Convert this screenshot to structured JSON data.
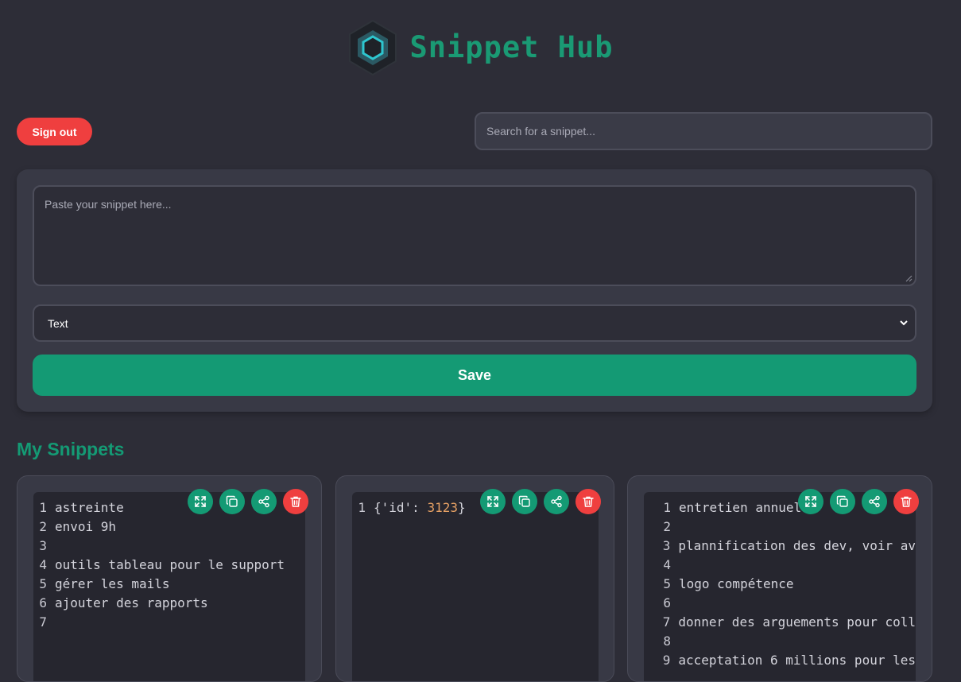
{
  "app": {
    "title": "Snippet Hub"
  },
  "toolbar": {
    "signout_label": "Sign out",
    "search_placeholder": "Search for a snippet..."
  },
  "editor": {
    "textarea_placeholder": "Paste your snippet here...",
    "language_selected": "Text",
    "save_label": "Save"
  },
  "snippets_section": {
    "title": "My Snippets"
  },
  "snippets": [
    {
      "lines": [
        {
          "n": "1",
          "text": "astreinte"
        },
        {
          "n": "2",
          "text": "envoi 9h"
        },
        {
          "n": "3",
          "text": ""
        },
        {
          "n": "4",
          "text": "outils tableau pour le support"
        },
        {
          "n": "5",
          "text": "gérer les mails"
        },
        {
          "n": "6",
          "text": "ajouter des rapports"
        },
        {
          "n": "7",
          "text": ""
        }
      ]
    },
    {
      "lines": [
        {
          "n": "1",
          "pre": "{'id': ",
          "num": "3123",
          "post": "}"
        }
      ]
    },
    {
      "lines": [
        {
          "n": "1",
          "text": "entretien annuel"
        },
        {
          "n": "2",
          "text": ""
        },
        {
          "n": "3",
          "text": "plannification des dev, voir av"
        },
        {
          "n": "4",
          "text": ""
        },
        {
          "n": "5",
          "text": "logo compétence"
        },
        {
          "n": "6",
          "text": ""
        },
        {
          "n": "7",
          "text": "donner des arguements pour coll"
        },
        {
          "n": "8",
          "text": ""
        },
        {
          "n": "9",
          "text": "acceptation 6 millions pour les"
        }
      ]
    }
  ],
  "card_actions": {
    "expand_icon": "expand-icon",
    "copy_icon": "copy-icon",
    "share_icon": "share-icon",
    "delete_icon": "trash-icon"
  },
  "colors": {
    "background": "#2d2d37",
    "panel": "#383945",
    "accent_green": "#149a74",
    "danger_red": "#ef3f3f",
    "number_token": "#e5a064"
  }
}
